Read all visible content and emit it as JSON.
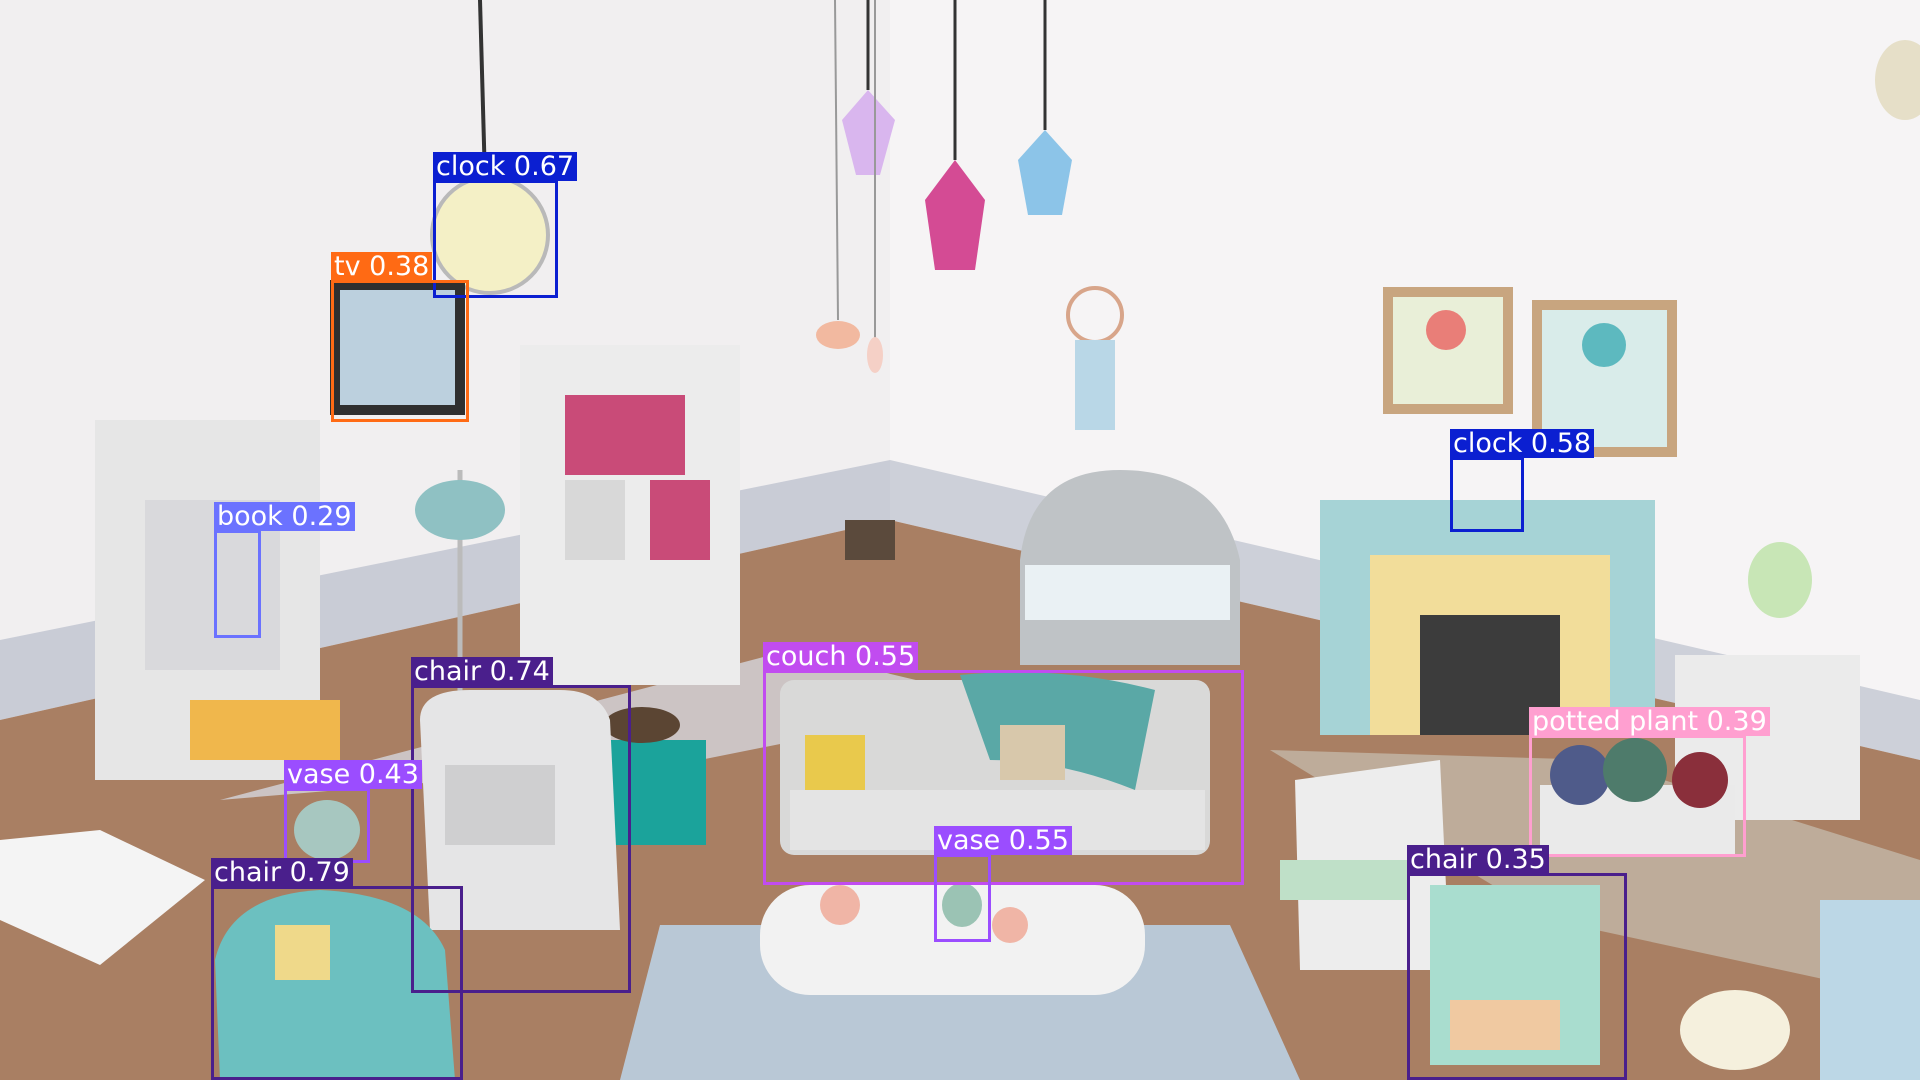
{
  "image": {
    "description_kind": "object detection overlay on rendered room scene",
    "wall_color": "#f4f2f3",
    "floor_color": "#a97f63",
    "wainscot_color": "#c9ccd6"
  },
  "detections": [
    {
      "id": "clock-1",
      "label": "clock 0.67",
      "color": "#0b1fd1"
    },
    {
      "id": "tv-1",
      "label": "tv 0.38",
      "color": "#ff6a14"
    },
    {
      "id": "book-1",
      "label": "book 0.29",
      "color": "#6b72ff"
    },
    {
      "id": "clock-2",
      "label": "clock 0.58",
      "color": "#0b1fd1"
    },
    {
      "id": "chair-1",
      "label": "chair 0.74",
      "color": "#4a1f8c"
    },
    {
      "id": "couch-1",
      "label": "couch 0.55",
      "color": "#c14cf0"
    },
    {
      "id": "vase-1",
      "label": "vase 0.43",
      "color": "#9b4dff"
    },
    {
      "id": "vase-2",
      "label": "vase 0.55",
      "color": "#9b4dff"
    },
    {
      "id": "chair-2",
      "label": "chair 0.79",
      "color": "#4a1f8c"
    },
    {
      "id": "potted-plant-1",
      "label": "potted plant 0.39",
      "color": "#ff9fd0"
    },
    {
      "id": "chair-3",
      "label": "chair 0.35",
      "color": "#4a1f8c"
    }
  ]
}
